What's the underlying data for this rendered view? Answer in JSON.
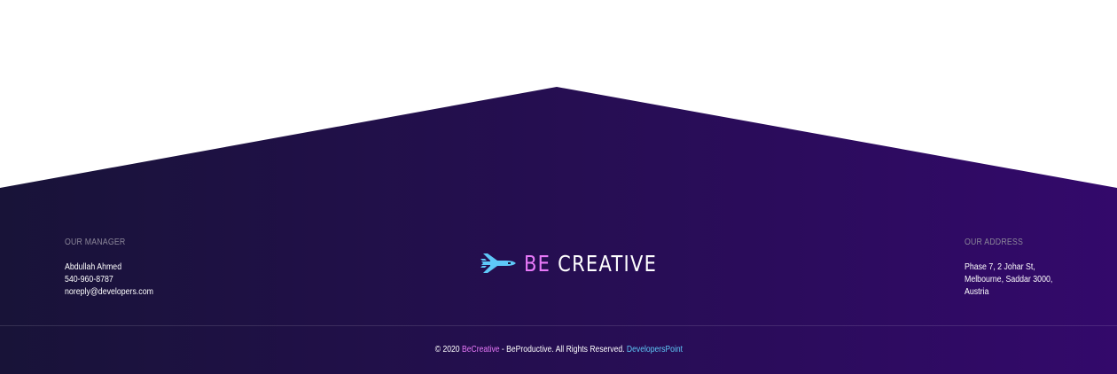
{
  "colors": {
    "gradient_start": "#181338",
    "gradient_end": "#33096b",
    "accent_pink": "#e879f9",
    "accent_cyan": "#5ec8f8",
    "heading_gray": "#8a8598"
  },
  "manager": {
    "heading": "OUR MANAGER",
    "name": "Abdullah Ahmed",
    "phone": "540-960-8787",
    "email": "noreply@developers.com"
  },
  "brand": {
    "icon": "space-shuttle-icon",
    "part1": "BE",
    "part2": "CREATIVE"
  },
  "address": {
    "heading": "OUR ADDRESS",
    "line1": "Phase 7, 2 Johar St,",
    "line2": "Melbourne, Saddar 3000,",
    "line3": "Austria"
  },
  "copyright": {
    "prefix": "© 2020 ",
    "brand_link": "BeCreative",
    "middle": " - BeProductive. All Rights Reserved. ",
    "dev_link": "DevelopersPoint"
  }
}
